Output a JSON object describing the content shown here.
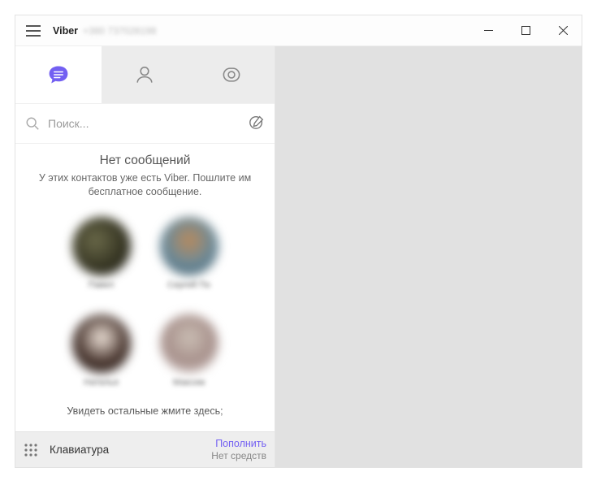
{
  "titlebar": {
    "app_name": "Viber",
    "phone": "+380 737028198"
  },
  "tabs": {
    "chats": "chats",
    "contacts": "contacts",
    "discover": "discover"
  },
  "search": {
    "placeholder": "Поиск..."
  },
  "empty": {
    "title": "Нет сообщений",
    "subtitle": "У этих контактов уже есть Viber. Пошлите им бесплатное сообщение."
  },
  "contacts_suggested": [
    {
      "name": "Павел",
      "bg": "radial-gradient(circle at 40% 40%, #6b6a4a 0%, #2e2d1d 65%, #111 100%)"
    },
    {
      "name": "Сергей По",
      "bg": "radial-gradient(circle at 50% 40%, #b98a5c 0%, #6a8a9a 55%, #2e4550 100%)"
    },
    {
      "name": "Наталья",
      "bg": "radial-gradient(circle at 50% 40%, #f3e7dd 0%, #4a3730 55%, #1a1310 100%)"
    },
    {
      "name": "Максим",
      "bg": "radial-gradient(circle at 50% 40%, #cbbfb5 0%, #a68f8a 55%, #f2efee 100%)"
    }
  ],
  "see_more": "Увидеть остальные жмите здесь;",
  "bottom": {
    "keyboard": "Клавиатура",
    "topup": "Пополнить",
    "no_funds": "Нет средств"
  },
  "colors": {
    "accent": "#7360f2"
  }
}
